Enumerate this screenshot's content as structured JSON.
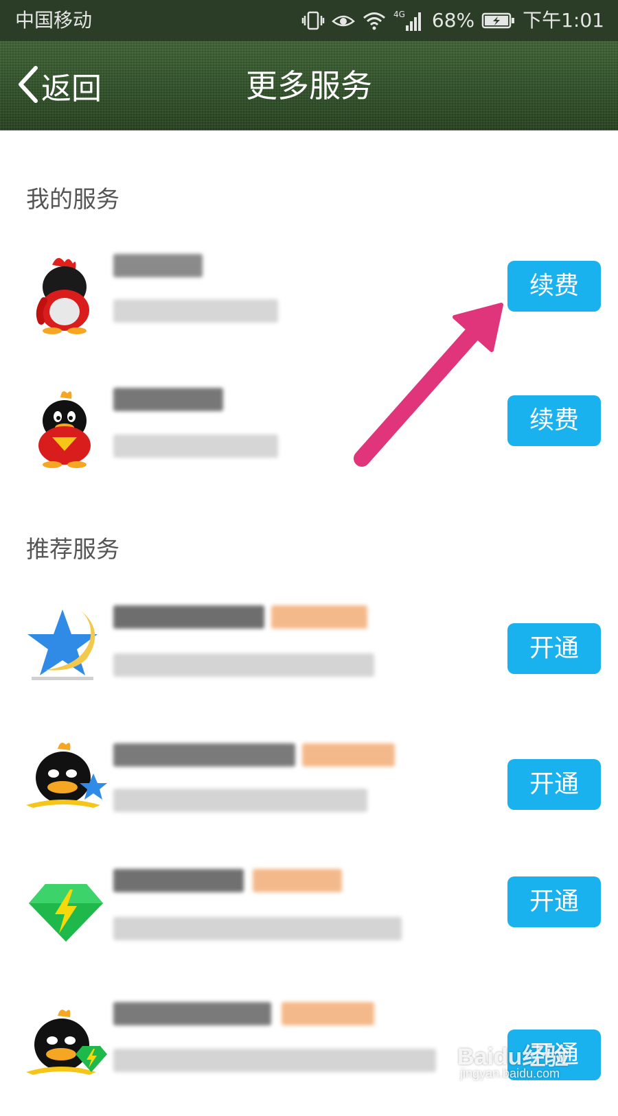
{
  "status_bar": {
    "carrier": "中国移动",
    "network": "4G",
    "battery": "68%",
    "time": "下午1:01",
    "icons": [
      "vibrate-icon",
      "eye-care-icon",
      "wifi-icon",
      "signal-icon",
      "battery-icon"
    ]
  },
  "title_bar": {
    "back_label": "返回",
    "title": "更多服务"
  },
  "sections": {
    "my_services": {
      "header": "我的服务",
      "rows": [
        {
          "icon": "qq-vip-red-penguin-icon",
          "button": "续费"
        },
        {
          "icon": "qq-penguin-icon",
          "button": "续费"
        }
      ]
    },
    "recommended": {
      "header": "推荐服务",
      "rows": [
        {
          "icon": "blue-star-moon-icon",
          "button": "开通"
        },
        {
          "icon": "penguin-star-icon",
          "button": "开通"
        },
        {
          "icon": "green-diamond-icon",
          "button": "开通"
        },
        {
          "icon": "penguin-green-diamond-icon",
          "button": "开通"
        }
      ]
    }
  },
  "colors": {
    "accent_button": "#1ab2ee",
    "title_bar": "#2f4f28",
    "annotation_arrow": "#e0357a"
  },
  "watermark": {
    "brand": "Baidu经验",
    "url": "jingyan.baidu.com"
  }
}
